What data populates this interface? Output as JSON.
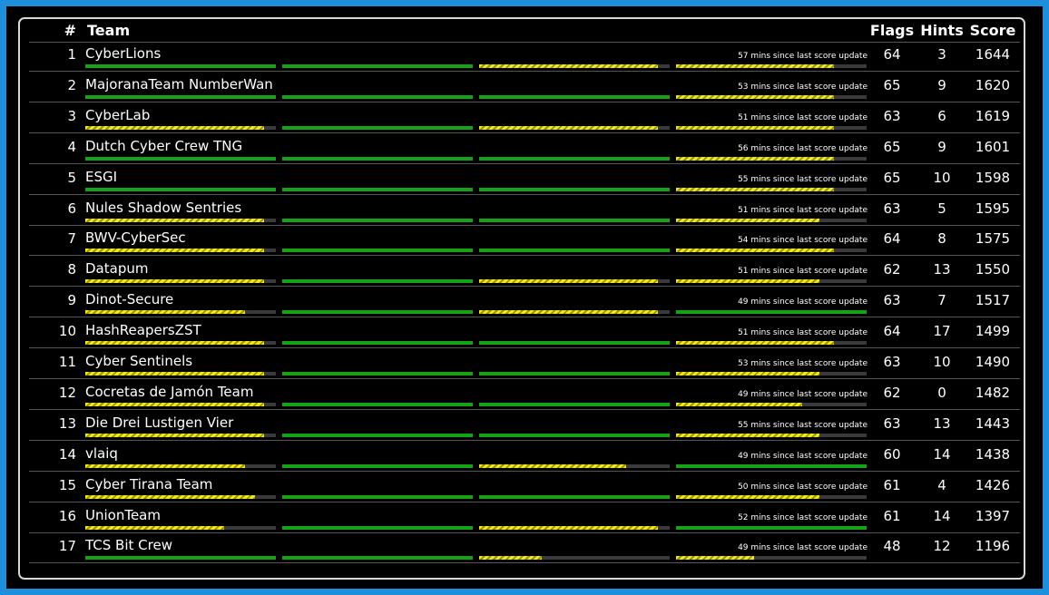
{
  "header": {
    "rank": "#",
    "team": "Team",
    "flags": "Flags",
    "hints": "Hints",
    "score": "Score"
  },
  "colors": {
    "complete": "#15a315",
    "partial": "#f2ea16",
    "empty": "#3a3a3a",
    "frame": "#1d8fdc"
  },
  "rows": [
    {
      "rank": "1",
      "team": "CyberLions",
      "update": "57 mins since last score update",
      "flags": "64",
      "hints": "3",
      "score": "1644",
      "progress": [
        {
          "v": 1,
          "c": "green"
        },
        {
          "v": 1,
          "c": "green"
        },
        {
          "v": 0.94,
          "c": "yellow"
        },
        {
          "v": 0.83,
          "c": "yellow"
        }
      ]
    },
    {
      "rank": "2",
      "team": "MajoranaTeam NumberWan",
      "update": "53 mins since last score update",
      "flags": "65",
      "hints": "9",
      "score": "1620",
      "progress": [
        {
          "v": 1,
          "c": "green"
        },
        {
          "v": 1,
          "c": "green"
        },
        {
          "v": 1,
          "c": "green"
        },
        {
          "v": 0.83,
          "c": "yellow"
        }
      ]
    },
    {
      "rank": "3",
      "team": "CyberLab",
      "update": "51 mins since last score update",
      "flags": "63",
      "hints": "6",
      "score": "1619",
      "progress": [
        {
          "v": 0.94,
          "c": "yellow"
        },
        {
          "v": 1,
          "c": "green"
        },
        {
          "v": 0.94,
          "c": "yellow"
        },
        {
          "v": 0.83,
          "c": "yellow"
        }
      ]
    },
    {
      "rank": "4",
      "team": "Dutch Cyber Crew TNG",
      "update": "56 mins since last score update",
      "flags": "65",
      "hints": "9",
      "score": "1601",
      "progress": [
        {
          "v": 1,
          "c": "green"
        },
        {
          "v": 1,
          "c": "green"
        },
        {
          "v": 1,
          "c": "green"
        },
        {
          "v": 0.83,
          "c": "yellow"
        }
      ]
    },
    {
      "rank": "5",
      "team": "ESGI",
      "update": "55 mins since last score update",
      "flags": "65",
      "hints": "10",
      "score": "1598",
      "progress": [
        {
          "v": 1,
          "c": "green"
        },
        {
          "v": 1,
          "c": "green"
        },
        {
          "v": 1,
          "c": "green"
        },
        {
          "v": 0.83,
          "c": "yellow"
        }
      ]
    },
    {
      "rank": "6",
      "team": "Nules Shadow Sentries",
      "update": "51 mins since last score update",
      "flags": "63",
      "hints": "5",
      "score": "1595",
      "progress": [
        {
          "v": 0.94,
          "c": "yellow"
        },
        {
          "v": 1,
          "c": "green"
        },
        {
          "v": 1,
          "c": "green"
        },
        {
          "v": 0.75,
          "c": "yellow"
        }
      ]
    },
    {
      "rank": "7",
      "team": "BWV-CyberSec",
      "update": "54 mins since last score update",
      "flags": "64",
      "hints": "8",
      "score": "1575",
      "progress": [
        {
          "v": 0.94,
          "c": "yellow"
        },
        {
          "v": 1,
          "c": "green"
        },
        {
          "v": 1,
          "c": "green"
        },
        {
          "v": 0.83,
          "c": "yellow"
        }
      ]
    },
    {
      "rank": "8",
      "team": "Datapum",
      "update": "51 mins since last score update",
      "flags": "62",
      "hints": "13",
      "score": "1550",
      "progress": [
        {
          "v": 0.94,
          "c": "yellow"
        },
        {
          "v": 1,
          "c": "green"
        },
        {
          "v": 0.94,
          "c": "yellow"
        },
        {
          "v": 0.75,
          "c": "yellow"
        }
      ]
    },
    {
      "rank": "9",
      "team": "Dinot-Secure",
      "update": "49 mins since last score update",
      "flags": "63",
      "hints": "7",
      "score": "1517",
      "progress": [
        {
          "v": 0.84,
          "c": "yellow"
        },
        {
          "v": 1,
          "c": "green"
        },
        {
          "v": 0.94,
          "c": "yellow"
        },
        {
          "v": 1,
          "c": "green"
        }
      ]
    },
    {
      "rank": "10",
      "team": "HashReapersZST",
      "update": "51 mins since last score update",
      "flags": "64",
      "hints": "17",
      "score": "1499",
      "progress": [
        {
          "v": 0.94,
          "c": "yellow"
        },
        {
          "v": 1,
          "c": "green"
        },
        {
          "v": 1,
          "c": "green"
        },
        {
          "v": 0.83,
          "c": "yellow"
        }
      ]
    },
    {
      "rank": "11",
      "team": "Cyber Sentinels",
      "update": "53 mins since last score update",
      "flags": "63",
      "hints": "10",
      "score": "1490",
      "progress": [
        {
          "v": 0.94,
          "c": "yellow"
        },
        {
          "v": 1,
          "c": "green"
        },
        {
          "v": 1,
          "c": "green"
        },
        {
          "v": 0.75,
          "c": "yellow"
        }
      ]
    },
    {
      "rank": "12",
      "team": "Cocretas de Jamón Team",
      "update": "49 mins since last score update",
      "flags": "62",
      "hints": "0",
      "score": "1482",
      "progress": [
        {
          "v": 0.94,
          "c": "yellow"
        },
        {
          "v": 1,
          "c": "green"
        },
        {
          "v": 1,
          "c": "green"
        },
        {
          "v": 0.66,
          "c": "yellow"
        }
      ]
    },
    {
      "rank": "13",
      "team": "Die Drei Lustigen Vier",
      "update": "55 mins since last score update",
      "flags": "63",
      "hints": "13",
      "score": "1443",
      "progress": [
        {
          "v": 0.94,
          "c": "yellow"
        },
        {
          "v": 1,
          "c": "green"
        },
        {
          "v": 1,
          "c": "green"
        },
        {
          "v": 0.75,
          "c": "yellow"
        }
      ]
    },
    {
      "rank": "14",
      "team": "vlaiq",
      "update": "49 mins since last score update",
      "flags": "60",
      "hints": "14",
      "score": "1438",
      "progress": [
        {
          "v": 0.84,
          "c": "yellow"
        },
        {
          "v": 1,
          "c": "green"
        },
        {
          "v": 0.77,
          "c": "yellow"
        },
        {
          "v": 1,
          "c": "green"
        }
      ]
    },
    {
      "rank": "15",
      "team": "Cyber Tirana Team",
      "update": "50 mins since last score update",
      "flags": "61",
      "hints": "4",
      "score": "1426",
      "progress": [
        {
          "v": 0.89,
          "c": "yellow"
        },
        {
          "v": 1,
          "c": "green"
        },
        {
          "v": 1,
          "c": "green"
        },
        {
          "v": 0.75,
          "c": "yellow"
        }
      ]
    },
    {
      "rank": "16",
      "team": "UnionTeam",
      "update": "52 mins since last score update",
      "flags": "61",
      "hints": "14",
      "score": "1397",
      "progress": [
        {
          "v": 0.73,
          "c": "yellow"
        },
        {
          "v": 1,
          "c": "green"
        },
        {
          "v": 0.94,
          "c": "yellow"
        },
        {
          "v": 1,
          "c": "green"
        }
      ]
    },
    {
      "rank": "17",
      "team": "TCS Bit Crew",
      "update": "49 mins since last score update",
      "flags": "48",
      "hints": "12",
      "score": "1196",
      "progress": [
        {
          "v": 1,
          "c": "green"
        },
        {
          "v": 1,
          "c": "green"
        },
        {
          "v": 0.33,
          "c": "yellow"
        },
        {
          "v": 0.41,
          "c": "yellow"
        }
      ]
    }
  ]
}
